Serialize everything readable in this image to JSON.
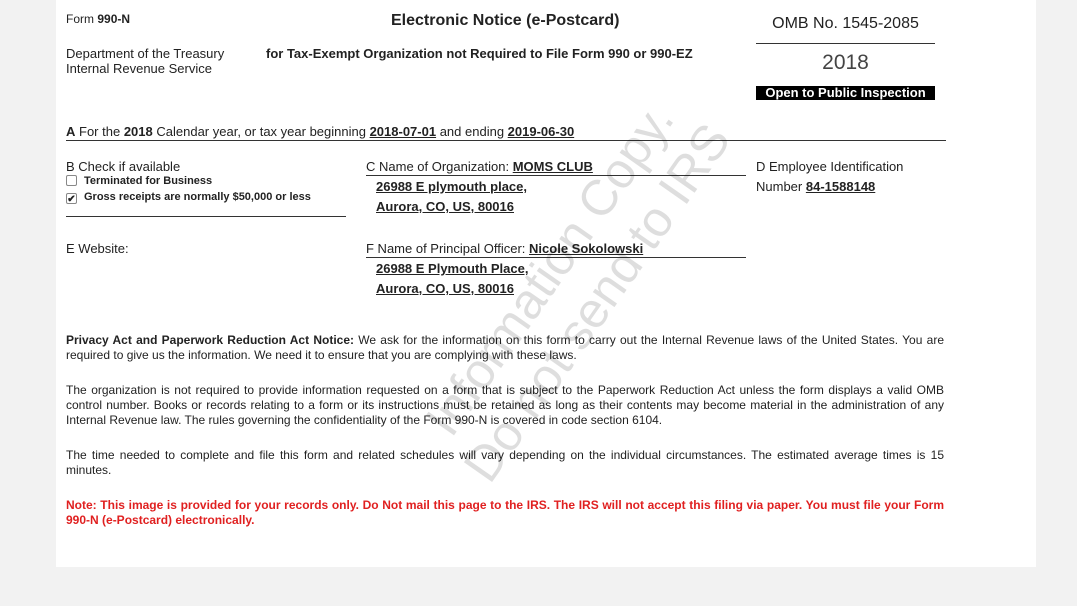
{
  "header": {
    "form_prefix": "Form",
    "form_number": "990-N",
    "title": "Electronic Notice (e-Postcard)",
    "subtitle": "for Tax-Exempt Organization not Required to File Form 990 or 990-EZ",
    "department_line1": "Department of the Treasury",
    "department_line2": "Internal Revenue Service",
    "omb": "OMB No. 1545-2085",
    "year": "2018",
    "public_badge": "Open to Public Inspection"
  },
  "section_a": {
    "letter": "A",
    "text1": "For the",
    "year": "2018",
    "text2": "Calendar year, or tax year beginning",
    "begin": "2018-07-01",
    "text3": "and ending",
    "end": "2019-06-30"
  },
  "section_b": {
    "label": "B Check if available",
    "checkboxes": [
      {
        "label": "Terminated for Business",
        "checked": false
      },
      {
        "label": "Gross receipts are normally $50,000 or less",
        "checked": true
      }
    ]
  },
  "section_c": {
    "label": "C Name of Organization:",
    "name": "MOMS CLUB",
    "address1": "26988 E plymouth place,",
    "address2": "Aurora, CO, US, 80016"
  },
  "section_d": {
    "label1": "D Employee Identification",
    "label2": "Number",
    "ein": "84-1588148"
  },
  "section_e": {
    "label": "E Website:"
  },
  "section_f": {
    "label": "F Name of Principal Officer:",
    "name": "Nicole Sokolowski",
    "address1": "26988 E Plymouth Place,",
    "address2": "Aurora, CO, US, 80016"
  },
  "notices": {
    "privacy_title": "Privacy Act and Paperwork Reduction Act Notice:",
    "privacy_text": " We ask for the information on this form to carry out the Internal Revenue laws of the United States. You are required to give us the information. We need it to ensure that you are complying with these laws.",
    "paperwork": "The organization is not required to provide information requested on a form that is subject to the Paperwork Reduction Act unless the form displays a valid OMB control number. Books or records relating to a form or its instructions must be retained as long as their contents may become material in the administration of any Internal Revenue law. The rules governing the confidentiality of the Form 990-N is covered in code section 6104.",
    "time": "The time needed to complete and file this form and related schedules will vary depending on the individual circumstances. The estimated average times is 15 minutes.",
    "note": "Note: This image is provided for your records only. Do Not mail this page to the IRS. The IRS will not accept this filing via paper. You must file your Form 990-N (e-Postcard) electronically."
  },
  "watermark": {
    "line1": "Information Copy.",
    "line2": "Do not send to IRS"
  }
}
